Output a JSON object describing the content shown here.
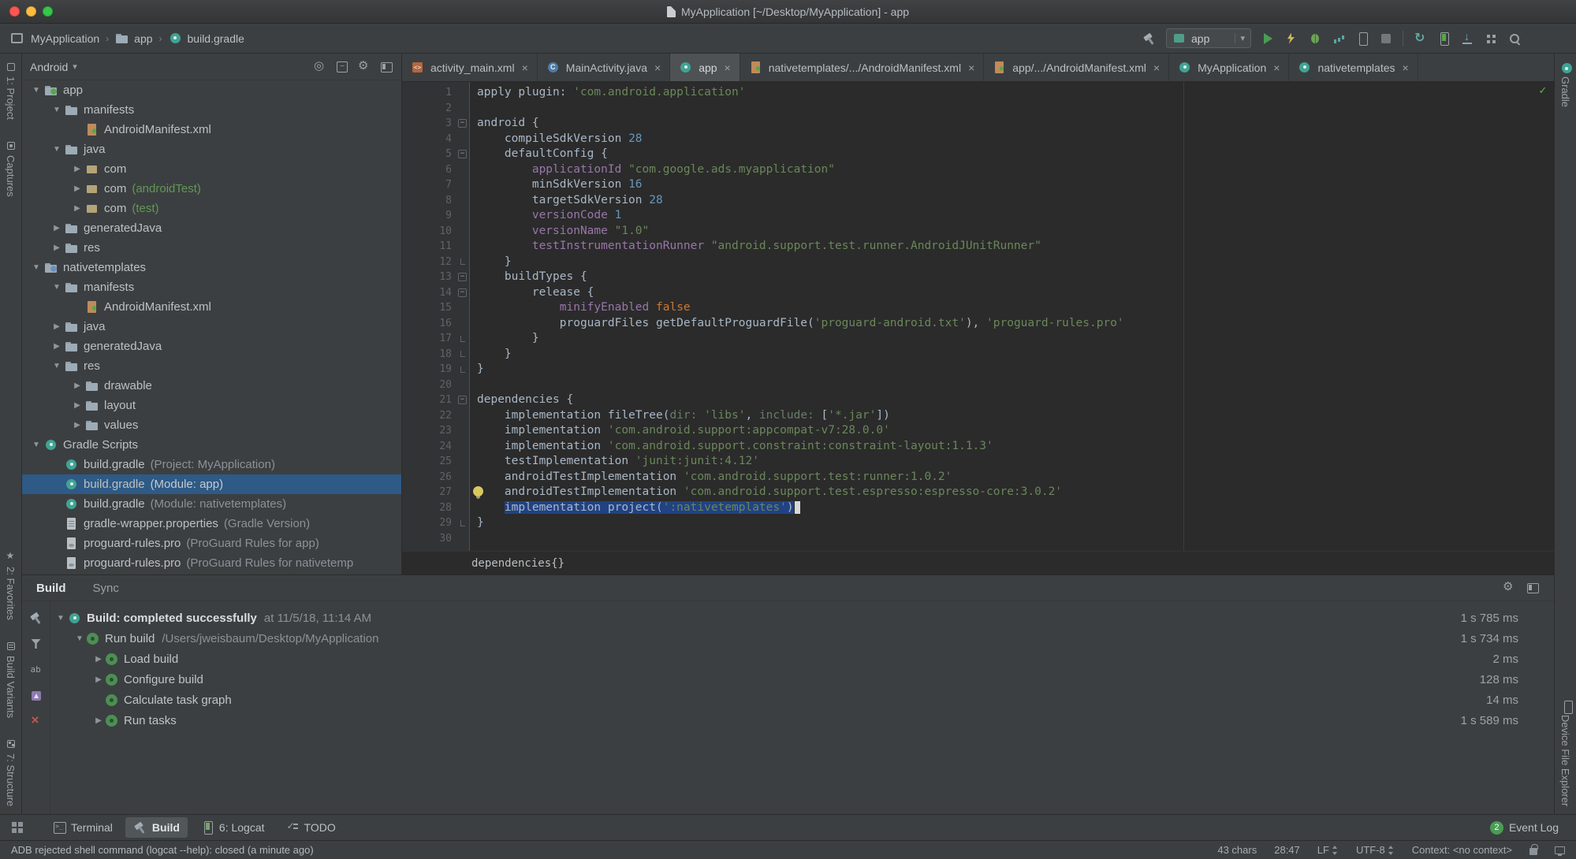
{
  "title_bar": {
    "title": "MyApplication [~/Desktop/MyApplication] - app"
  },
  "navbar": {
    "breadcrumbs": [
      {
        "label": "MyApplication"
      },
      {
        "label": "app"
      },
      {
        "label": "build.gradle"
      }
    ],
    "toolbar": {
      "run_config": "app",
      "items": [
        {
          "name": "build-hammer-icon"
        },
        {
          "name": "run-config-select"
        },
        {
          "name": "run-icon"
        },
        {
          "name": "instant-run-icon"
        },
        {
          "name": "debug-icon"
        },
        {
          "name": "profiler-icon"
        },
        {
          "name": "attach-debugger-icon"
        },
        {
          "name": "stop-icon"
        },
        {
          "name": "separator"
        },
        {
          "name": "sync-gradle-icon"
        },
        {
          "name": "avd-manager-icon"
        },
        {
          "name": "sdk-manager-icon"
        },
        {
          "name": "project-structure-icon"
        },
        {
          "name": "search-icon"
        }
      ]
    }
  },
  "left_strip": {
    "top": [
      {
        "label": "1: Project",
        "icon": "project-tool-icon"
      },
      {
        "label": "Captures",
        "icon": "captures-tool-icon"
      }
    ],
    "bottom": [
      {
        "label": "2: Favorites",
        "icon": "favorites-tool-icon"
      },
      {
        "label": "Build Variants",
        "icon": "build-variants-tool-icon"
      },
      {
        "label": "7: Structure",
        "icon": "structure-tool-icon"
      }
    ]
  },
  "right_strip": {
    "top": [
      {
        "label": "Gradle",
        "icon": "gradle-tool-icon"
      }
    ],
    "bottom": [
      {
        "label": "Device File Explorer",
        "icon": "device-file-explorer-tool-icon"
      }
    ]
  },
  "project_panel": {
    "view": "Android",
    "header_icons": [
      "locate-file-icon",
      "collapse-all-icon",
      "settings-icon",
      "hide-panel-icon"
    ],
    "tree": [
      {
        "arrow": "open",
        "icon": "module",
        "label": "app",
        "indent": 0
      },
      {
        "arrow": "open",
        "icon": "folder",
        "label": "manifests",
        "indent": 1
      },
      {
        "arrow": "none",
        "icon": "manifest",
        "label": "AndroidManifest.xml",
        "indent": 2
      },
      {
        "arrow": "open",
        "icon": "folder",
        "label": "java",
        "indent": 1
      },
      {
        "arrow": "closed",
        "icon": "package",
        "label": "com",
        "indent": 2
      },
      {
        "arrow": "closed",
        "icon": "package",
        "label": "com",
        "suffix": "(androidTest)",
        "suffix_green": true,
        "indent": 2
      },
      {
        "arrow": "closed",
        "icon": "package",
        "label": "com",
        "suffix": "(test)",
        "suffix_green": true,
        "indent": 2
      },
      {
        "arrow": "closed",
        "icon": "folder",
        "label": "generatedJava",
        "indent": 1
      },
      {
        "arrow": "closed",
        "icon": "folder",
        "label": "res",
        "indent": 1
      },
      {
        "arrow": "open",
        "icon": "library",
        "label": "nativetemplates",
        "indent": 0
      },
      {
        "arrow": "open",
        "icon": "folder",
        "label": "manifests",
        "indent": 1
      },
      {
        "arrow": "none",
        "icon": "manifest",
        "label": "AndroidManifest.xml",
        "indent": 2
      },
      {
        "arrow": "closed",
        "icon": "folder",
        "label": "java",
        "indent": 1
      },
      {
        "arrow": "closed",
        "icon": "folder",
        "label": "generatedJava",
        "indent": 1
      },
      {
        "arrow": "open",
        "icon": "folder",
        "label": "res",
        "indent": 1
      },
      {
        "arrow": "closed",
        "icon": "folder",
        "label": "drawable",
        "indent": 2
      },
      {
        "arrow": "closed",
        "icon": "folder",
        "label": "layout",
        "indent": 2
      },
      {
        "arrow": "closed",
        "icon": "folder",
        "label": "values",
        "indent": 2
      },
      {
        "arrow": "open",
        "icon": "gradle",
        "label": "Gradle Scripts",
        "indent": 0
      },
      {
        "arrow": "none",
        "icon": "gradle",
        "label": "build.gradle",
        "suffix": "(Project: MyApplication)",
        "indent": 1
      },
      {
        "arrow": "none",
        "icon": "gradle",
        "label": "build.gradle",
        "suffix": "(Module: app)",
        "indent": 1,
        "selected": true
      },
      {
        "arrow": "none",
        "icon": "gradle",
        "label": "build.gradle",
        "suffix": "(Module: nativetemplates)",
        "indent": 1
      },
      {
        "arrow": "none",
        "icon": "props",
        "label": "gradle-wrapper.properties",
        "suffix": "(Gradle Version)",
        "indent": 1
      },
      {
        "arrow": "none",
        "icon": "pro",
        "label": "proguard-rules.pro",
        "suffix": "(ProGuard Rules for app)",
        "indent": 1
      },
      {
        "arrow": "none",
        "icon": "pro",
        "label": "proguard-rules.pro",
        "suffix": "(ProGuard Rules for nativetemp",
        "indent": 1
      }
    ]
  },
  "editor": {
    "tabs": [
      {
        "label": "activity_main.xml",
        "icon": "xml"
      },
      {
        "label": "MainActivity.java",
        "icon": "class"
      },
      {
        "label": "app",
        "icon": "gradle",
        "active": true
      },
      {
        "label": "nativetemplates/.../AndroidManifest.xml",
        "icon": "manifest"
      },
      {
        "label": "app/.../AndroidManifest.xml",
        "icon": "manifest"
      },
      {
        "label": "MyApplication",
        "icon": "gradle"
      },
      {
        "label": "nativetemplates",
        "icon": "gradle"
      }
    ],
    "breadcrumb": "dependencies{}",
    "code": [
      {
        "num": 1,
        "fold": "",
        "tokens": [
          [
            "d",
            "apply plugin: "
          ],
          [
            "s",
            "'com.android.application'"
          ]
        ]
      },
      {
        "num": 2,
        "fold": "",
        "tokens": []
      },
      {
        "num": 3,
        "fold": "open",
        "tokens": [
          [
            "d",
            "android {"
          ]
        ]
      },
      {
        "num": 4,
        "fold": "",
        "tokens": [
          [
            "d",
            "    compileSdkVersion "
          ],
          [
            "n",
            "28"
          ]
        ]
      },
      {
        "num": 5,
        "fold": "open",
        "tokens": [
          [
            "d",
            "    defaultConfig {"
          ]
        ]
      },
      {
        "num": 6,
        "fold": "",
        "tokens": [
          [
            "d",
            "        "
          ],
          [
            "p",
            "applicationId"
          ],
          [
            "d",
            " "
          ],
          [
            "s",
            "\"com.google.ads.myapplication\""
          ]
        ]
      },
      {
        "num": 7,
        "fold": "",
        "tokens": [
          [
            "d",
            "        minSdkVersion "
          ],
          [
            "n",
            "16"
          ]
        ]
      },
      {
        "num": 8,
        "fold": "",
        "tokens": [
          [
            "d",
            "        targetSdkVersion "
          ],
          [
            "n",
            "28"
          ]
        ]
      },
      {
        "num": 9,
        "fold": "",
        "tokens": [
          [
            "d",
            "        "
          ],
          [
            "p",
            "versionCode"
          ],
          [
            "d",
            " "
          ],
          [
            "n",
            "1"
          ]
        ]
      },
      {
        "num": 10,
        "fold": "",
        "tokens": [
          [
            "d",
            "        "
          ],
          [
            "p",
            "versionName"
          ],
          [
            "d",
            " "
          ],
          [
            "s",
            "\"1.0\""
          ]
        ]
      },
      {
        "num": 11,
        "fold": "",
        "tokens": [
          [
            "d",
            "        "
          ],
          [
            "p",
            "testInstrumentationRunner"
          ],
          [
            "d",
            " "
          ],
          [
            "s",
            "\"android.support.test.runner.AndroidJUnitRunner\""
          ]
        ]
      },
      {
        "num": 12,
        "fold": "end",
        "tokens": [
          [
            "d",
            "    }"
          ]
        ]
      },
      {
        "num": 13,
        "fold": "open",
        "tokens": [
          [
            "d",
            "    buildTypes {"
          ]
        ]
      },
      {
        "num": 14,
        "fold": "open",
        "tokens": [
          [
            "d",
            "        release {"
          ]
        ]
      },
      {
        "num": 15,
        "fold": "",
        "tokens": [
          [
            "d",
            "            "
          ],
          [
            "p",
            "minifyEnabled"
          ],
          [
            "d",
            " "
          ],
          [
            "k",
            "false"
          ]
        ]
      },
      {
        "num": 16,
        "fold": "",
        "tokens": [
          [
            "d",
            "            proguardFiles getDefaultProguardFile("
          ],
          [
            "s",
            "'proguard-android.txt'"
          ],
          [
            "d",
            "), "
          ],
          [
            "s",
            "'proguard-rules.pro'"
          ]
        ]
      },
      {
        "num": 17,
        "fold": "end",
        "tokens": [
          [
            "d",
            "        }"
          ]
        ]
      },
      {
        "num": 18,
        "fold": "end",
        "tokens": [
          [
            "d",
            "    }"
          ]
        ]
      },
      {
        "num": 19,
        "fold": "end",
        "tokens": [
          [
            "d",
            "}"
          ]
        ]
      },
      {
        "num": 20,
        "fold": "",
        "tokens": []
      },
      {
        "num": 21,
        "fold": "open",
        "tokens": [
          [
            "d",
            "dependencies {"
          ]
        ]
      },
      {
        "num": 22,
        "fold": "",
        "tokens": [
          [
            "d",
            "    implementation fileTree("
          ],
          [
            "m",
            "dir:"
          ],
          [
            "d",
            " "
          ],
          [
            "s",
            "'libs'"
          ],
          [
            "d",
            ", "
          ],
          [
            "m",
            "include:"
          ],
          [
            "d",
            " ["
          ],
          [
            "s",
            "'*.jar'"
          ],
          [
            "d",
            "])"
          ]
        ]
      },
      {
        "num": 23,
        "fold": "",
        "tokens": [
          [
            "d",
            "    implementation "
          ],
          [
            "s",
            "'com.android.support:appcompat-v7:28.0.0'"
          ]
        ]
      },
      {
        "num": 24,
        "fold": "",
        "tokens": [
          [
            "d",
            "    implementation "
          ],
          [
            "s",
            "'com.android.support.constraint:constraint-layout:1.1.3'"
          ]
        ]
      },
      {
        "num": 25,
        "fold": "",
        "tokens": [
          [
            "d",
            "    testImplementation "
          ],
          [
            "s",
            "'junit:junit:4.12'"
          ]
        ]
      },
      {
        "num": 26,
        "fold": "",
        "tokens": [
          [
            "d",
            "    androidTestImplementation "
          ],
          [
            "s",
            "'com.android.support.test:runner:1.0.2'"
          ]
        ]
      },
      {
        "num": 27,
        "fold": "",
        "tokens": [
          [
            "d",
            "    androidTestImplementation "
          ],
          [
            "s",
            "'com.android.support.test.espresso:espresso-core:3.0.2'"
          ]
        ]
      },
      {
        "num": 28,
        "fold": "",
        "caret": true,
        "tokens": [
          [
            "d",
            "    "
          ],
          [
            "d sel",
            "implementation project("
          ],
          [
            "s sel",
            "':nativetemplates'"
          ],
          [
            "d sel",
            ")"
          ]
        ]
      },
      {
        "num": 29,
        "fold": "end",
        "tokens": [
          [
            "d",
            "}"
          ]
        ]
      },
      {
        "num": 30,
        "fold": "",
        "tokens": []
      }
    ]
  },
  "build_panel": {
    "tabs": [
      "Build",
      "Sync"
    ],
    "header_icons": [
      "build-settings-icon",
      "hide-build-panel-icon"
    ],
    "side_icons": [
      "rerun-build-icon",
      "filter-icon",
      "console-output-icon",
      "export-icon",
      "close-icon"
    ],
    "rows": [
      {
        "arrow": "open",
        "icon": "gradle",
        "label": "Build: completed successfully",
        "bold": true,
        "suffix": "at 11/5/18, 11:14 AM",
        "time": "1 s 785 ms",
        "indent": 0
      },
      {
        "arrow": "open",
        "icon": "task",
        "label": "Run build",
        "suffix": "/Users/jweisbaum/Desktop/MyApplication",
        "time": "1 s 734 ms",
        "indent": 1
      },
      {
        "arrow": "closed",
        "icon": "task",
        "label": "Load build",
        "time": "2 ms",
        "indent": 2
      },
      {
        "arrow": "closed",
        "icon": "task",
        "label": "Configure build",
        "time": "128 ms",
        "indent": 2
      },
      {
        "arrow": "none",
        "icon": "task",
        "label": "Calculate task graph",
        "time": "14 ms",
        "indent": 2
      },
      {
        "arrow": "closed",
        "icon": "task",
        "label": "Run tasks",
        "time": "1 s 589 ms",
        "indent": 2
      }
    ]
  },
  "bottom_bar": {
    "tabs": [
      {
        "label": "Terminal",
        "icon": "terminal-icon"
      },
      {
        "label": "Build",
        "icon": "hammer-icon",
        "active": true
      },
      {
        "label": "6: Logcat",
        "icon": "logcat-icon"
      },
      {
        "label": "TODO",
        "icon": "todo-icon"
      }
    ],
    "event_log": "Event Log",
    "event_count": "2"
  },
  "status_bar": {
    "message": "ADB rejected shell command (logcat --help): closed (a minute ago)",
    "selection_info": "43 chars",
    "caret_position": "28:47",
    "line_separator": "LF",
    "encoding": "UTF-8",
    "context": "Context: <no context>"
  }
}
